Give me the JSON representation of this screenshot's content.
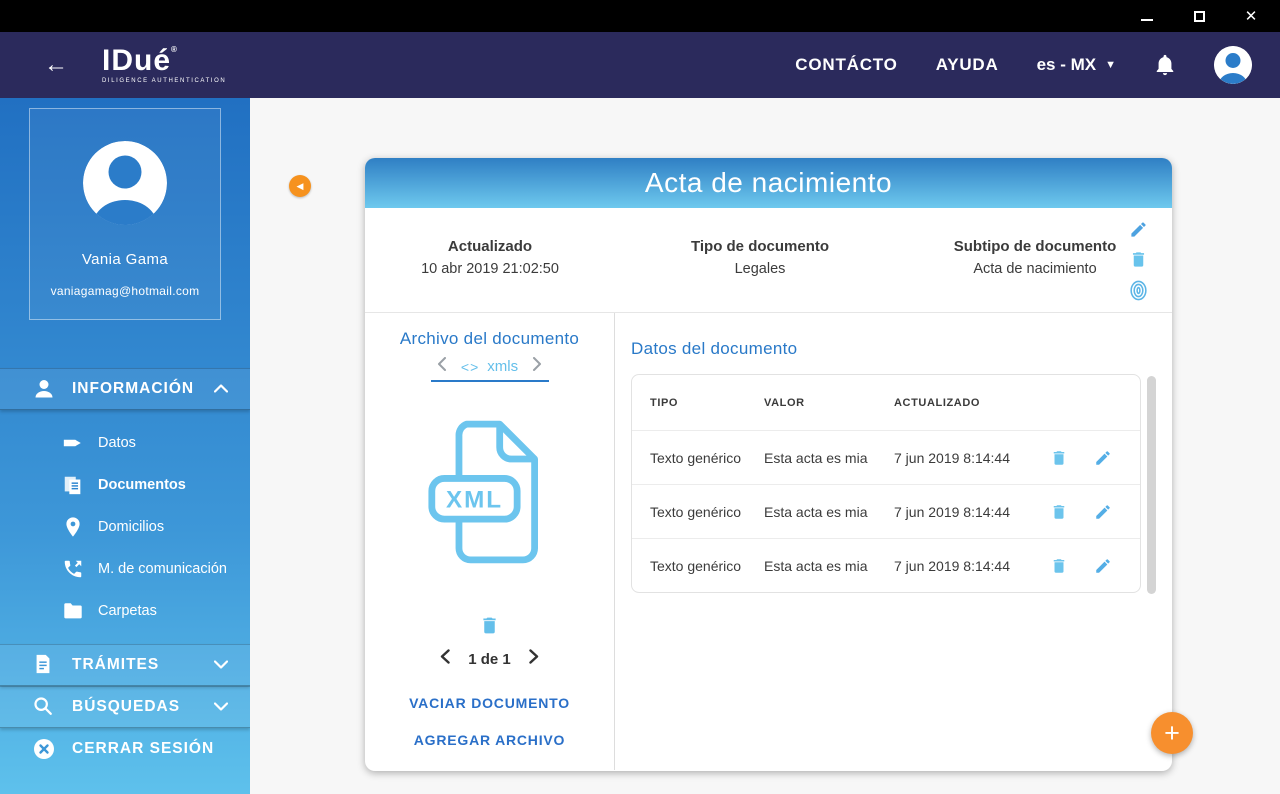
{
  "window": {
    "close_glyph": "✕"
  },
  "app_header": {
    "back_glyph": "←",
    "logo": "IDué",
    "logo_mark": "®",
    "logo_tagline": "DILIGENCE AUTHENTICATION",
    "nav_contacto": "CONTÁCTO",
    "nav_ayuda": "AYUDA",
    "language": "es - MX",
    "language_caret": "▼"
  },
  "sidebar": {
    "profile": {
      "name": "Vania Gama",
      "email": "vaniagamag@hotmail.com"
    },
    "info_section": {
      "label": "INFORMACIÓN",
      "icon": "person-icon",
      "state": "expanded"
    },
    "items": [
      {
        "label": "Datos",
        "icon": "tag-icon"
      },
      {
        "label": "Documentos",
        "icon": "documents-icon"
      },
      {
        "label": "Domicilios",
        "icon": "location-pin-icon"
      },
      {
        "label": "M. de comunicación",
        "icon": "phone-icon"
      },
      {
        "label": "Carpetas",
        "icon": "folder-icon"
      }
    ],
    "tramites_section": {
      "label": "TRÁMITES",
      "icon": "file-icon",
      "state": "collapsed"
    },
    "busquedas_section": {
      "label": "BÚSQUEDAS",
      "icon": "search-icon",
      "state": "collapsed"
    },
    "logout": {
      "label": "CERRAR SESIÓN",
      "icon": "close-circle-icon"
    }
  },
  "main": {
    "collapse_glyph": "◀",
    "fab_glyph": "+"
  },
  "document_card": {
    "title": "Acta de nacimiento",
    "meta": {
      "actualizado_label": "Actualizado",
      "actualizado_value": "10 abr 2019 21:02:50",
      "tipo_label": "Tipo de documento",
      "tipo_value": "Legales",
      "subtipo_label": "Subtipo de documento",
      "subtipo_value": "Acta de nacimiento"
    },
    "archivo": {
      "heading": "Archivo del documento",
      "tab_code_glyph": "<>",
      "tab_label": "xmls",
      "file_type_label": "XML",
      "pagination": "1 de 1",
      "vaciar_link": "VACIAR DOCUMENTO",
      "agregar_link": "AGREGAR ARCHIVO"
    },
    "datos": {
      "heading": "Datos del documento",
      "table": {
        "headers": [
          "TIPO",
          "VALOR",
          "ACTUALIZADO"
        ],
        "rows": [
          {
            "tipo": "Texto genérico",
            "valor": "Esta acta es mia",
            "actualizado": "7 jun 2019 8:14:44"
          },
          {
            "tipo": "Texto genérico",
            "valor": "Esta acta es mia",
            "actualizado": "7 jun 2019 8:14:44"
          },
          {
            "tipo": "Texto genérico",
            "valor": "Esta acta es mia",
            "actualizado": "7 jun 2019 8:14:44"
          }
        ]
      }
    }
  },
  "colors": {
    "header_navy": "#2b2a5c",
    "sidebar_top": "#2170c2",
    "sidebar_bottom": "#5ec1ec",
    "accent_blue": "#2979c8",
    "light_blue": "#64bfea",
    "orange": "#f78f2e"
  }
}
